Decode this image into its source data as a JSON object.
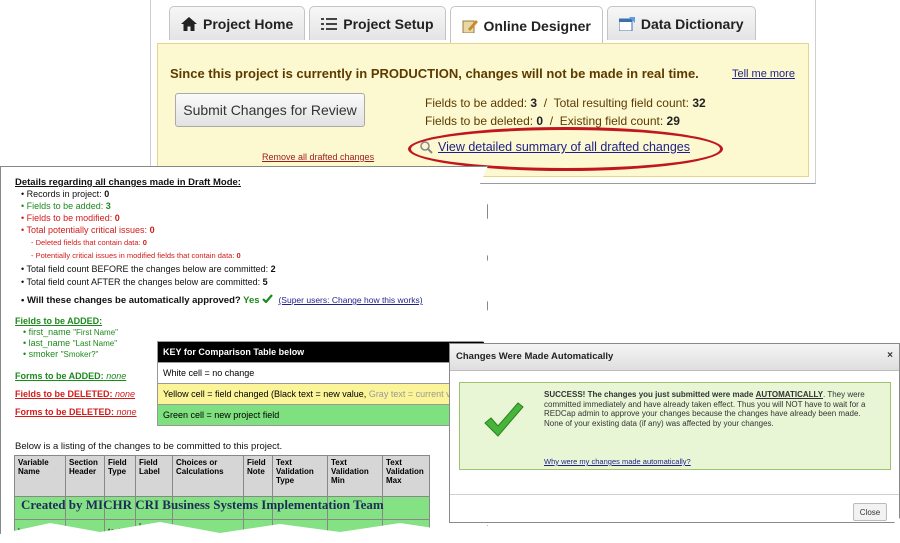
{
  "tabs": [
    {
      "label": "Project Home",
      "icon": "home-icon"
    },
    {
      "label": "Project Setup",
      "icon": "list-icon"
    },
    {
      "label": "Online Designer",
      "icon": "designer-icon",
      "active": true
    },
    {
      "label": "Data Dictionary",
      "icon": "spreadsheet-icon"
    }
  ],
  "notice": {
    "text": "Since this project is currently in PRODUCTION, changes will not be made in real time.",
    "tell_more": "Tell me more",
    "submit_label": "Submit Changes for Review",
    "fields_added_label": "Fields to be added:",
    "fields_added": "3",
    "total_resulting_label": "Total resulting field count:",
    "total_resulting": "32",
    "fields_deleted_label": "Fields to be deleted:",
    "fields_deleted": "0",
    "existing_label": "Existing field count:",
    "existing": "29",
    "remove_link": "Remove all drafted changes",
    "view_summary": "View detailed summary of all drafted changes"
  },
  "details": {
    "title": "Details regarding all changes made in Draft Mode:",
    "lines": [
      {
        "label": "• Records in project:",
        "value": "0",
        "color": "black"
      },
      {
        "label": "• Fields to be added:",
        "value": "3",
        "color": "green"
      },
      {
        "label": "• Fields to be modified:",
        "value": "0",
        "color": "red"
      },
      {
        "label": "• Total potentially critical issues:",
        "value": "0",
        "color": "red"
      },
      {
        "label": "- Deleted fields that contain data:",
        "value": "0",
        "color": "red"
      },
      {
        "label": "- Potentially critical issues in modified fields that contain data:",
        "value": "0",
        "color": "red"
      },
      {
        "label": "• Total field count BEFORE the changes below are committed:",
        "value": "2",
        "color": "black"
      },
      {
        "label": "• Total field count AFTER the changes below are committed:",
        "value": "5",
        "color": "black"
      }
    ],
    "auto_approve_label": "• Will these changes be automatically approved?",
    "auto_approve_value": "Yes",
    "super_users_link": "(Super users: Change how this works)",
    "fields_added_head": "Fields to be ADDED:",
    "added_fields": [
      {
        "name": "first_name",
        "label": "\"First Name\""
      },
      {
        "name": "last_name",
        "label": "\"Last Name\""
      },
      {
        "name": "smoker",
        "label": "\"Smoker?\""
      }
    ],
    "forms_added_head": "Forms to be ADDED:",
    "fields_deleted_head": "Fields to be DELETED:",
    "forms_deleted_head": "Forms to be DELETED:",
    "none_text": "none",
    "listing_line": "Below is a listing of the changes to be committed to this project."
  },
  "key_table": {
    "title": "KEY for Comparison Table below",
    "white": "White cell = no change",
    "yellow_main": "Yellow cell = field changed (Black text = new value,",
    "yellow_gray": "Gray text = current v",
    "green": "Green cell = new project field"
  },
  "comparison_table": {
    "headers": [
      "Variable Name",
      "Section Header",
      "Field Type",
      "Field Label",
      "Choices or Calculations",
      "Field Note",
      "Text Validation Type",
      "Text Validation Min",
      "Text Validation Max"
    ],
    "row_fragment": {
      "variable": "last_name",
      "type": "text",
      "label": "Last Name"
    }
  },
  "watermark": "Created by MICHR CRI Business Systems Implementation Team",
  "dialog": {
    "title": "Changes Were Made Automatically",
    "message_intro": "SUCCESS! The changes you just submitted were made",
    "message_bold": "AUTOMATICALLY",
    "message_rest": ". They were committed immediately and have already taken effect. Thus you will NOT have to wait for a REDCap admin to approve your changes because the changes have already been made. None of your existing data (if any) was affected by your changes.",
    "why_link": "Why were my changes made automatically?",
    "close_label": "Close",
    "close_x": "×"
  },
  "colors": {
    "notice_bg": "#fcf8cf",
    "ellipse": "#c0161f",
    "success_bg": "#e9f6d6",
    "green_cell": "#84e184",
    "yellow_cell": "#fbf498"
  }
}
